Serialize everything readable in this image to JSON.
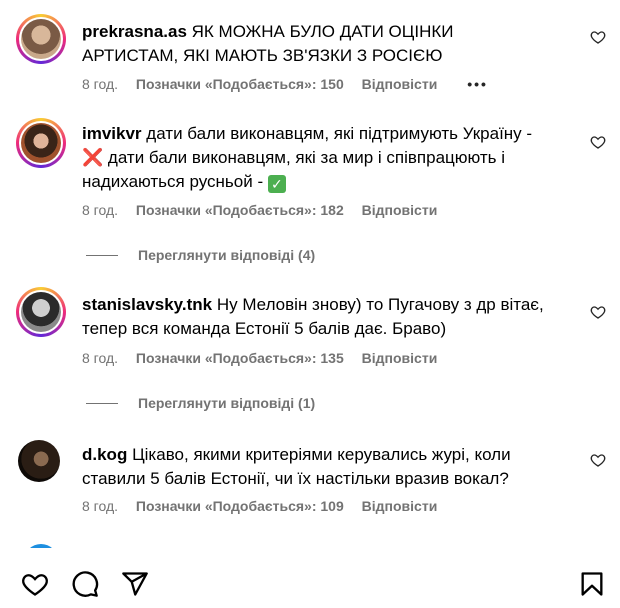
{
  "comments": [
    {
      "username": "prekrasna.as",
      "text": "ЯК МОЖНА БУЛО ДАТИ ОЦІНКИ АРТИСТАМ, ЯКІ МАЮТЬ ЗВ'ЯЗКИ З РОСІЄЮ",
      "time": "8 год.",
      "likes": "Позначки «Подобається»: 150",
      "reply": "Відповісти",
      "more": "•••"
    },
    {
      "username": "imvikvr",
      "text_part1": "дати бали виконавцям, які підтримують Україну -",
      "mark1": "❌",
      "text_part2": "дати бали виконавцям, які за мир і співпрацюють і надихаються русньой -",
      "mark2": "✅",
      "time": "8 год.",
      "likes": "Позначки «Подобається»: 182",
      "reply": "Відповісти",
      "view_replies": "Переглянути відповіді (4)"
    },
    {
      "username": "stanislavsky.tnk",
      "text": "Ну Меловін знову) то Пугачову з др вітає, тепер вся команда Естонії 5 балів дає. Браво)",
      "time": "8 год.",
      "likes": "Позначки «Подобається»: 135",
      "reply": "Відповісти",
      "view_replies": "Переглянути відповіді (1)"
    },
    {
      "username": "d.kog",
      "text": "Цікаво, якими критеріями керувались журі, коли ставили 5 балів Естонії, чи їх настільки вразив вокал?",
      "time": "8 год.",
      "likes": "Позначки «Подобається»: 109",
      "reply": "Відповісти"
    }
  ],
  "bottom_bar": {
    "icons": [
      "heart-icon",
      "comment-icon",
      "share-icon",
      "bookmark-icon"
    ]
  },
  "colors": {
    "secondary_text": "#737373",
    "story_ring": [
      "#f9ce34",
      "#ee2a7b",
      "#6228d7"
    ]
  }
}
